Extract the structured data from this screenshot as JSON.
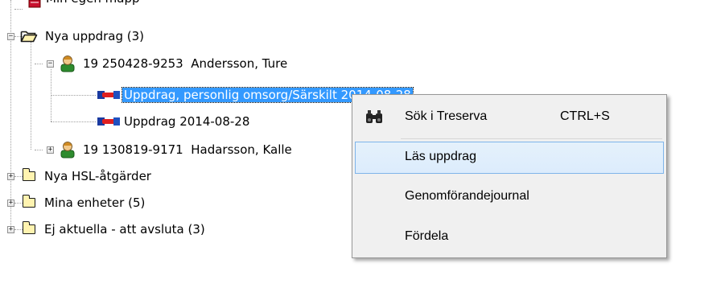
{
  "tree": {
    "items": [
      {
        "label": "Min egen mapp"
      },
      {
        "label": "Nya uppdrag (3)"
      },
      {
        "label": "19 250428-9253  Andersson, Ture"
      },
      {
        "label": "Uppdrag, personlig omsorg/Särskilt 2014-08-28"
      },
      {
        "label": "Uppdrag 2014-08-28"
      },
      {
        "label": "19 130819-9171  Hadarsson, Kalle"
      },
      {
        "label": "Nya HSL-åtgärder"
      },
      {
        "label": "Mina enheter (5)"
      },
      {
        "label": "Ej aktuella - att avsluta (3)"
      }
    ]
  },
  "context_menu": {
    "items": [
      {
        "label": "Sök i Treserva",
        "shortcut": "CTRL+S"
      },
      {
        "label": "Läs uppdrag"
      },
      {
        "label": "Genomförandejournal"
      },
      {
        "label": "Fördela"
      }
    ]
  }
}
